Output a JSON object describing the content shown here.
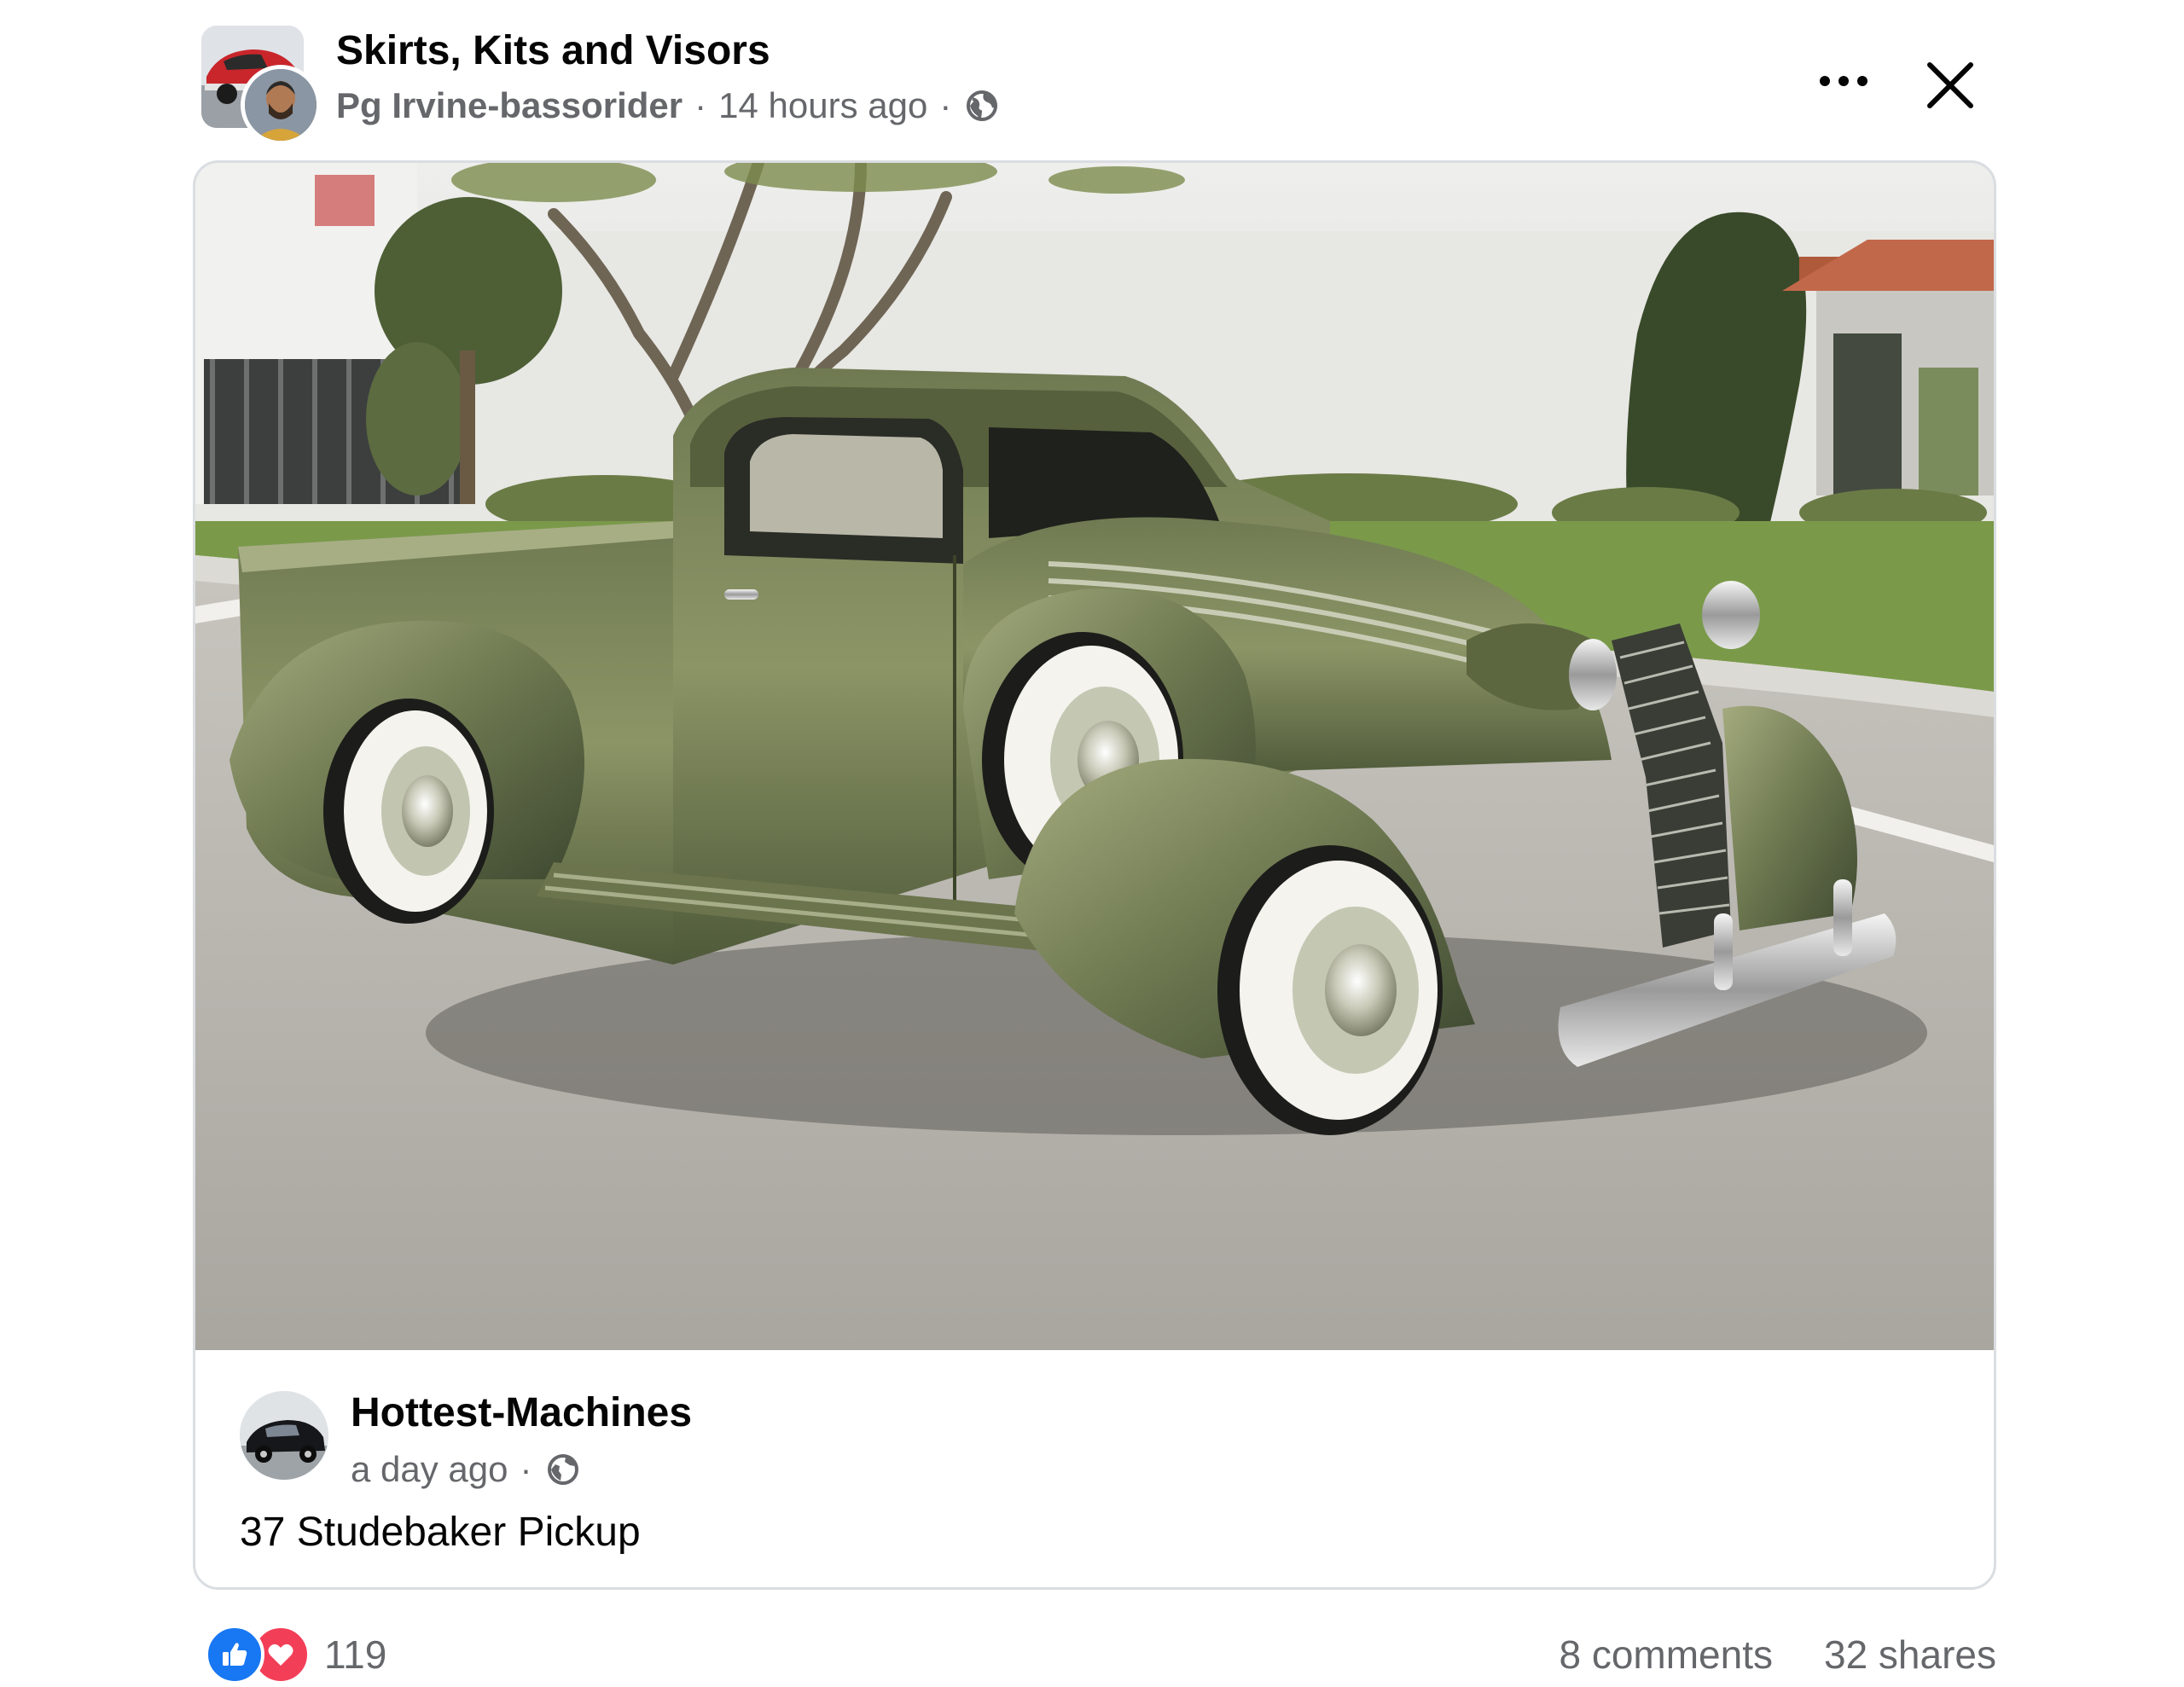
{
  "post": {
    "group_name": "Skirts, Kits and Visors",
    "author": "Pg Irvine-bassorider",
    "separator": "·",
    "timestamp": "14 hours ago",
    "privacy_icon": "globe-icon",
    "more_icon": "more-options-icon",
    "close_icon": "close-icon"
  },
  "shared_post": {
    "photo_subject": "photo-of-green-pickup-truck",
    "page_name": "Hottest-Machines",
    "timestamp": "a day ago",
    "separator": "·",
    "privacy_icon": "globe-icon",
    "caption": "37 Studebaker Pickup"
  },
  "engagement": {
    "reactions": [
      "like-icon",
      "love-icon"
    ],
    "reaction_count": "119",
    "comments": "8 comments",
    "shares": "32 shares"
  },
  "colors": {
    "like_blue": "#1877f2",
    "love_red": "#f33e58",
    "secondary_text": "#65676b",
    "primary_text": "#050505",
    "card_border": "#dadde1"
  }
}
